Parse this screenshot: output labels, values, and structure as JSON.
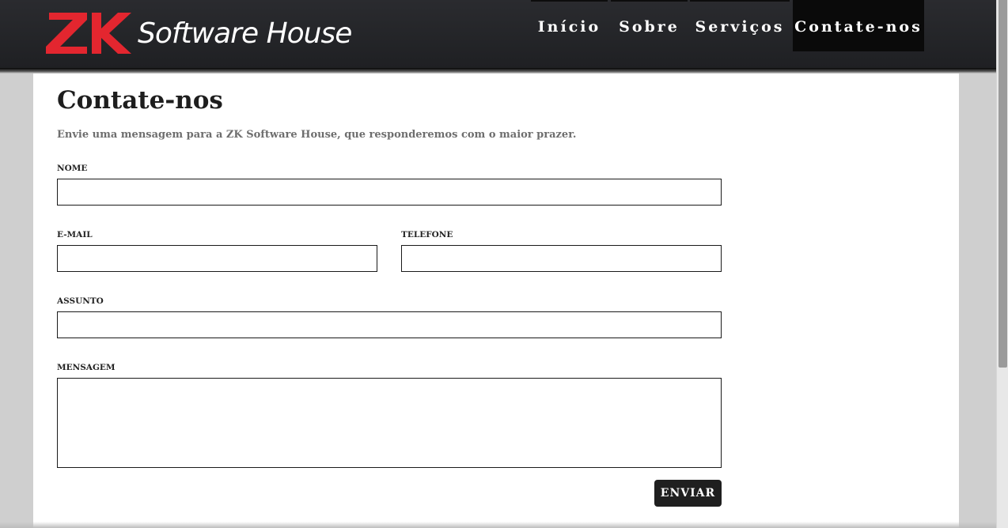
{
  "brand": {
    "logo_mark": "ZK",
    "logo_text": "Software House",
    "logo_mark_color": "#e3262f"
  },
  "nav": {
    "items": [
      {
        "label": "Início",
        "active": false
      },
      {
        "label": "Sobre",
        "active": false
      },
      {
        "label": "Serviços",
        "active": false
      },
      {
        "label": "Contate-nos",
        "active": true
      }
    ]
  },
  "main": {
    "title": "Contate-nos",
    "intro": "Envie uma mensagem para a ZK Software House, que responderemos com o maior prazer."
  },
  "form": {
    "name_label": "NOME",
    "name_value": "",
    "email_label": "E-MAIL",
    "email_value": "",
    "phone_label": "TELEFONE",
    "phone_value": "",
    "subject_label": "ASSUNTO",
    "subject_value": "",
    "message_label": "MENSAGEM",
    "message_value": "",
    "submit_label": "ENVIAR"
  },
  "colors": {
    "header_bg": "#222326",
    "accent": "#e3262f",
    "button_bg": "#1f1f1f"
  }
}
